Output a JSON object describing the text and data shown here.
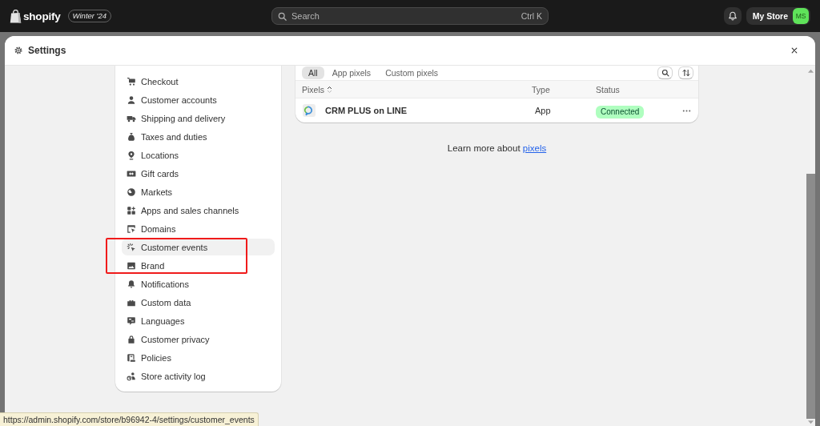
{
  "topbar": {
    "logo": "shopify",
    "edition": "Winter '24",
    "search": {
      "placeholder": "Search",
      "shortcut": "Ctrl K"
    },
    "store": {
      "name": "My Store",
      "initials": "MS"
    }
  },
  "dialog": {
    "title": "Settings"
  },
  "sidebar": {
    "items": [
      {
        "label": "Checkout",
        "selected": false,
        "annotated": false
      },
      {
        "label": "Customer accounts",
        "selected": false,
        "annotated": false
      },
      {
        "label": "Shipping and delivery",
        "selected": false,
        "annotated": false
      },
      {
        "label": "Taxes and duties",
        "selected": false,
        "annotated": false
      },
      {
        "label": "Locations",
        "selected": false,
        "annotated": false
      },
      {
        "label": "Gift cards",
        "selected": false,
        "annotated": false
      },
      {
        "label": "Markets",
        "selected": false,
        "annotated": false
      },
      {
        "label": "Apps and sales channels",
        "selected": false,
        "annotated": false
      },
      {
        "label": "Domains",
        "selected": false,
        "annotated": false
      },
      {
        "label": "Customer events",
        "selected": true,
        "annotated": true
      },
      {
        "label": "Brand",
        "selected": false,
        "annotated": true
      },
      {
        "label": "Notifications",
        "selected": false,
        "annotated": false
      },
      {
        "label": "Custom data",
        "selected": false,
        "annotated": false
      },
      {
        "label": "Languages",
        "selected": false,
        "annotated": false
      },
      {
        "label": "Customer privacy",
        "selected": false,
        "annotated": false
      },
      {
        "label": "Policies",
        "selected": false,
        "annotated": false
      },
      {
        "label": "Store activity log",
        "selected": false,
        "annotated": false
      }
    ]
  },
  "pixels": {
    "tabs": [
      {
        "label": "All",
        "selected": true
      },
      {
        "label": "App pixels",
        "selected": false
      },
      {
        "label": "Custom pixels",
        "selected": false
      }
    ],
    "columns": [
      {
        "label": "Pixels",
        "sorted": true
      },
      {
        "label": "Type",
        "sorted": false
      },
      {
        "label": "Status",
        "sorted": false
      }
    ],
    "rows": [
      {
        "name": "CRM PLUS on LINE",
        "type": "App",
        "status": "Connected",
        "color": "#affebf"
      }
    ]
  },
  "learn_more": {
    "text": "Learn more about",
    "link": "pixels"
  },
  "status_bar": {
    "url": "https://admin.shopify.com/store/b96942-4/settings/customer_events"
  }
}
